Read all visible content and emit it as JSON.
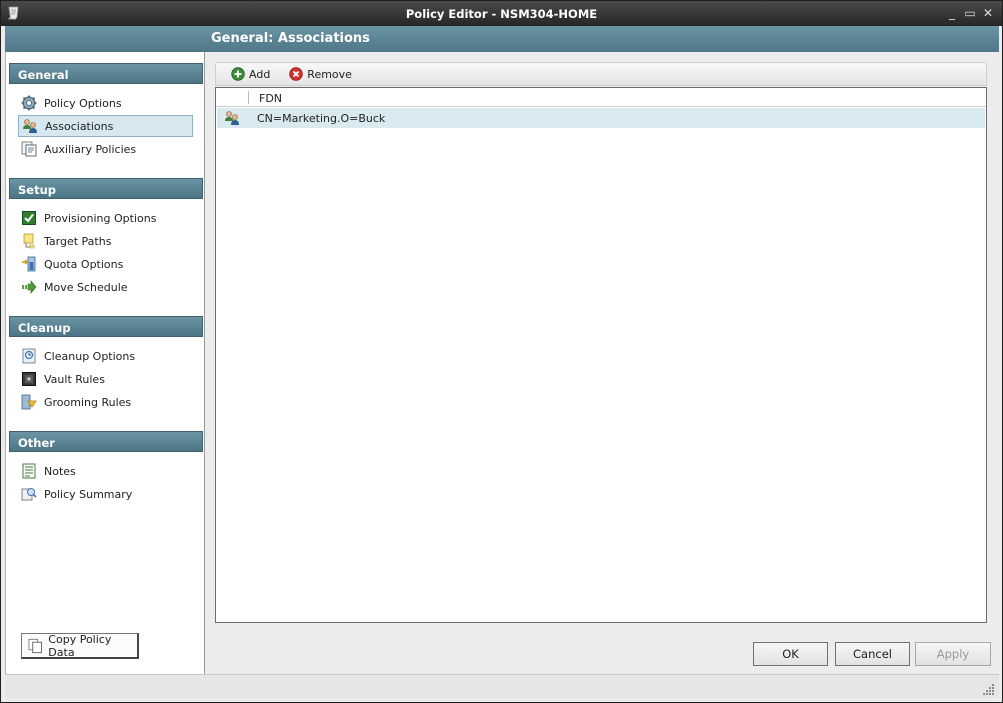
{
  "window": {
    "title": "Policy Editor - NSM304-HOME",
    "minimize_glyph": "_",
    "maximize_glyph": "▭",
    "close_glyph": "✕"
  },
  "page_title": "General: Associations",
  "sidebar": {
    "sections": [
      {
        "title": "General",
        "items": [
          {
            "label": "Policy Options",
            "icon": "gear-icon"
          },
          {
            "label": "Associations",
            "icon": "users-icon",
            "selected": true
          },
          {
            "label": "Auxiliary Policies",
            "icon": "auxiliary-policies-icon"
          }
        ]
      },
      {
        "title": "Setup",
        "items": [
          {
            "label": "Provisioning Options",
            "icon": "checkbox-icon"
          },
          {
            "label": "Target Paths",
            "icon": "folder-path-icon"
          },
          {
            "label": "Quota Options",
            "icon": "quota-icon"
          },
          {
            "label": "Move Schedule",
            "icon": "arrow-right-icon"
          }
        ]
      },
      {
        "title": "Cleanup",
        "items": [
          {
            "label": "Cleanup Options",
            "icon": "cleanup-icon"
          },
          {
            "label": "Vault Rules",
            "icon": "vault-icon"
          },
          {
            "label": "Grooming Rules",
            "icon": "grooming-icon"
          }
        ]
      },
      {
        "title": "Other",
        "items": [
          {
            "label": "Notes",
            "icon": "notes-icon"
          },
          {
            "label": "Policy Summary",
            "icon": "summary-icon"
          }
        ]
      }
    ],
    "copy_button": "Copy Policy Data"
  },
  "toolbar": {
    "add_label": "Add",
    "remove_label": "Remove"
  },
  "list": {
    "column_header": "FDN",
    "rows": [
      {
        "value": "CN=Marketing.O=Buck",
        "icon": "group-icon"
      }
    ]
  },
  "buttons": {
    "ok": "OK",
    "cancel": "Cancel",
    "apply": "Apply"
  },
  "colors": {
    "accent": "#5b8696",
    "selected_row": "#d8e9f0",
    "titlebar": "#2e2e2e"
  }
}
